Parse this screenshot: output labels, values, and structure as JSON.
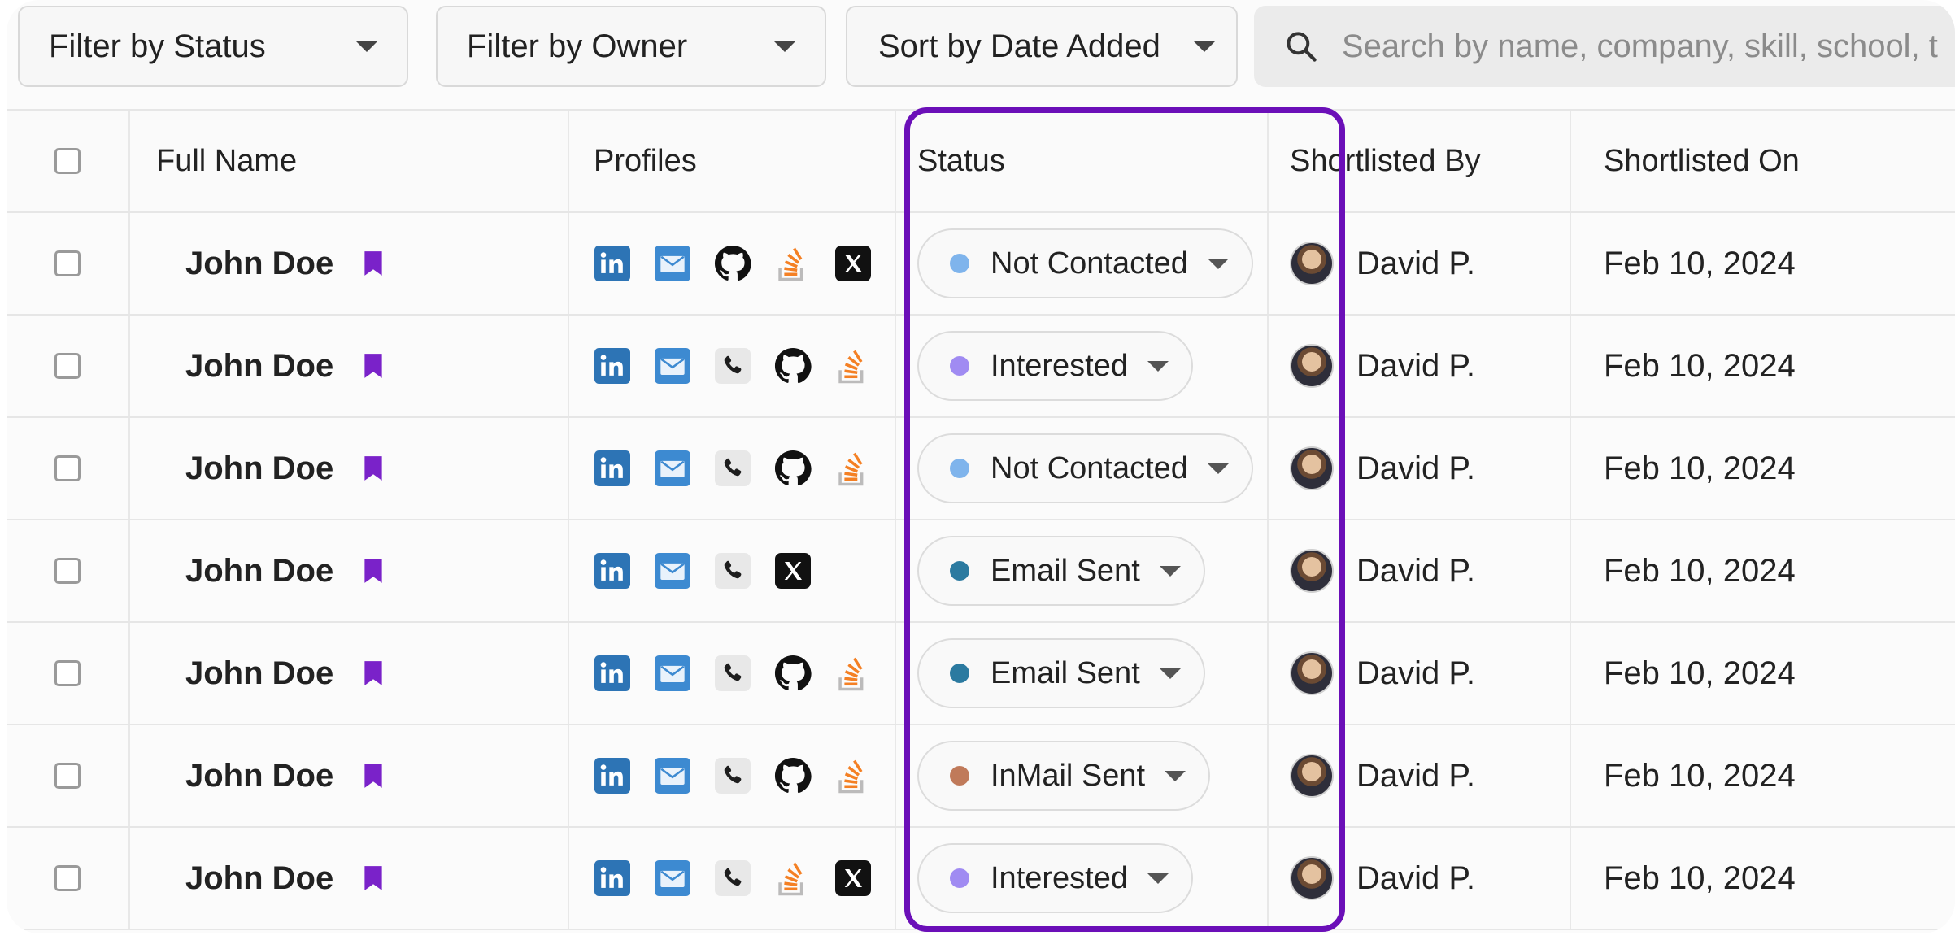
{
  "toolbar": {
    "filter_status": "Filter by Status",
    "filter_owner": "Filter by Owner",
    "sort": "Sort by Date Added",
    "search_placeholder": "Search by name, company, skill, school, t"
  },
  "columns": [
    "Full Name",
    "Profiles",
    "Status",
    "Shortlisted By",
    "Shortlisted On"
  ],
  "status_colors": {
    "Not Contacted": "#7fb4ec",
    "Interested": "#a08bf2",
    "Email Sent": "#2b7aa0",
    "InMail Sent": "#c07a5a"
  },
  "accent_color": "#6b0fb8",
  "rows": [
    {
      "name": "John Doe",
      "profiles": [
        "linkedin",
        "email",
        "github",
        "stackoverflow",
        "x"
      ],
      "status": "Not Contacted",
      "by": "David P.",
      "date": "Feb 10, 2024"
    },
    {
      "name": "John Doe",
      "profiles": [
        "linkedin",
        "email",
        "phone",
        "github",
        "stackoverflow"
      ],
      "status": "Interested",
      "by": "David P.",
      "date": "Feb 10, 2024"
    },
    {
      "name": "John Doe",
      "profiles": [
        "linkedin",
        "email",
        "phone",
        "github",
        "stackoverflow"
      ],
      "status": "Not Contacted",
      "by": "David P.",
      "date": "Feb 10, 2024"
    },
    {
      "name": "John Doe",
      "profiles": [
        "linkedin",
        "email",
        "phone",
        "x"
      ],
      "status": "Email Sent",
      "by": "David P.",
      "date": "Feb 10, 2024"
    },
    {
      "name": "John Doe",
      "profiles": [
        "linkedin",
        "email",
        "phone",
        "github",
        "stackoverflow"
      ],
      "status": "Email Sent",
      "by": "David P.",
      "date": "Feb 10, 2024"
    },
    {
      "name": "John Doe",
      "profiles": [
        "linkedin",
        "email",
        "phone",
        "github",
        "stackoverflow"
      ],
      "status": "InMail Sent",
      "by": "David P.",
      "date": "Feb 10, 2024"
    },
    {
      "name": "John Doe",
      "profiles": [
        "linkedin",
        "email",
        "phone",
        "stackoverflow",
        "x"
      ],
      "status": "Interested",
      "by": "David P.",
      "date": "Feb 10, 2024"
    }
  ]
}
